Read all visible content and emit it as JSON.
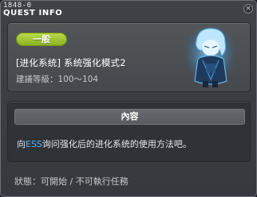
{
  "window": {
    "quest_id": "1848-0",
    "title": "QUEST INFO",
    "close_glyph": "×"
  },
  "summary": {
    "category": "一般",
    "quest_name": "[进化系统] 系统强化模式2",
    "level_text": "建議等級：100～104",
    "npc_portrait": "npc-portrait-icon"
  },
  "content": {
    "header": "內容",
    "text_prefix": "向",
    "text_highlight": "ESS",
    "text_suffix": "询问强化后的进化系统的使用方法吧。"
  },
  "status": {
    "text": "狀態：可開始 / 不可執行任務"
  },
  "colors": {
    "badge_green": "#9cc42e",
    "highlight_blue": "#56b8ff",
    "panel_dark": "#2f3236"
  }
}
